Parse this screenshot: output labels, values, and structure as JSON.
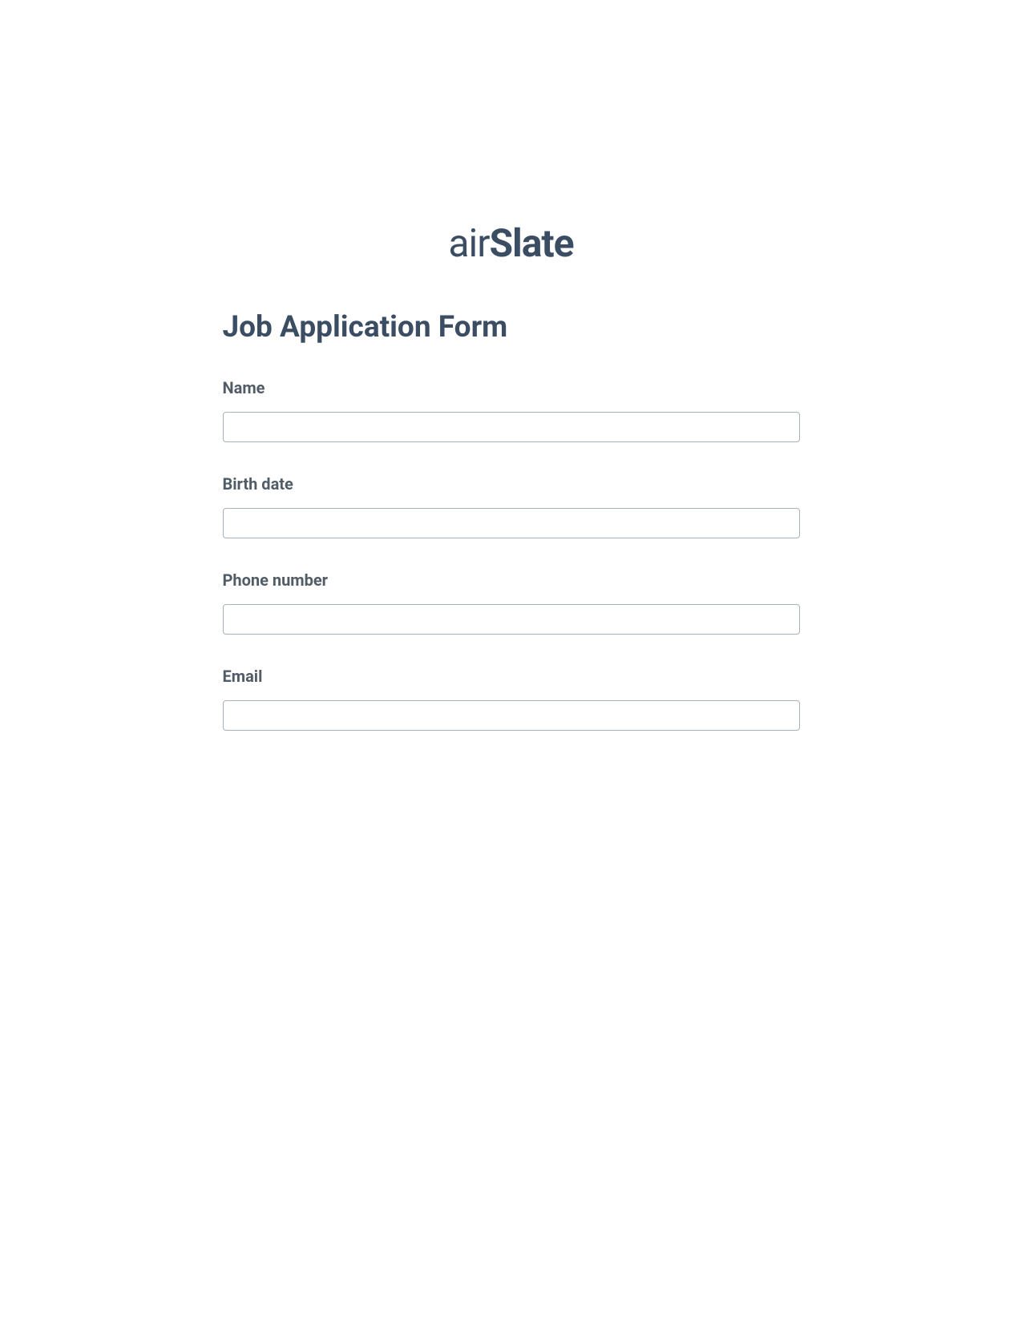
{
  "logo": {
    "text_air": "air",
    "text_slate": "Slate"
  },
  "form": {
    "title": "Job Application Form",
    "fields": {
      "name": {
        "label": "Name",
        "value": ""
      },
      "birthdate": {
        "label": "Birth date",
        "value": ""
      },
      "phone": {
        "label": "Phone number",
        "value": ""
      },
      "email": {
        "label": "Email",
        "value": ""
      }
    }
  }
}
